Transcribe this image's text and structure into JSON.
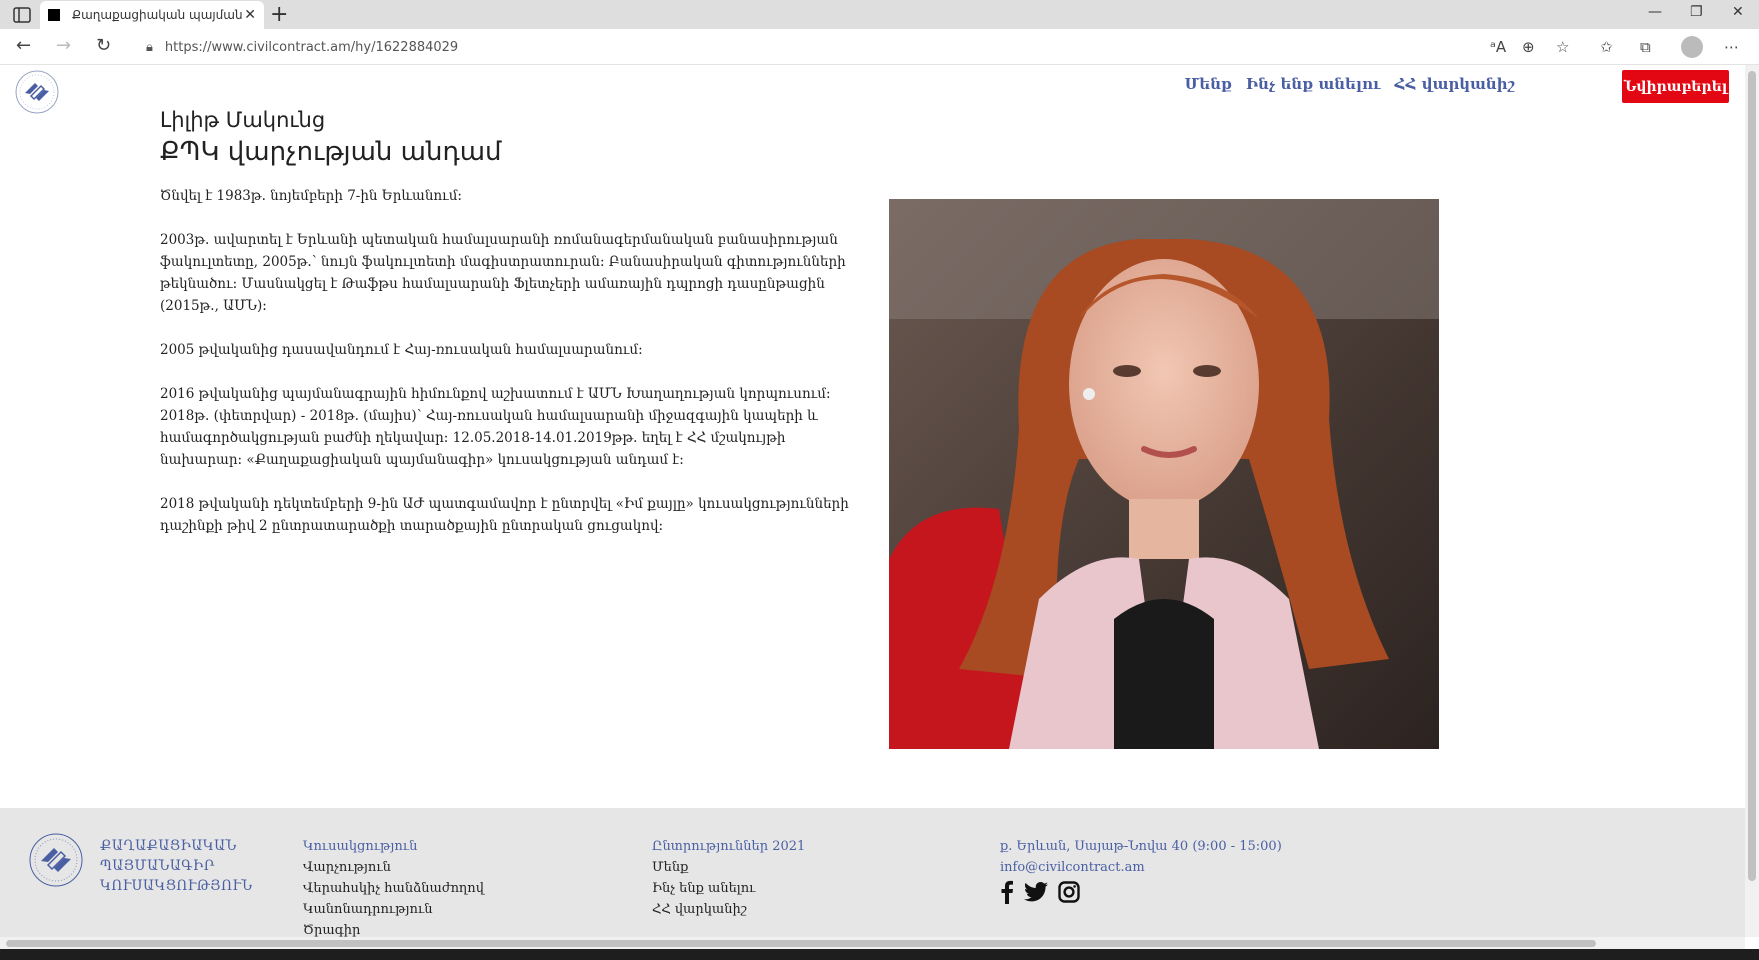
{
  "browser": {
    "tab_title": "Քաղաքացիական պայմանագ",
    "url": "https://www.civilcontract.am/hy/1622884029"
  },
  "site": {
    "nav": [
      "Մենք",
      "Ինչ ենք անելու",
      "ՀՀ վարկանիշ"
    ],
    "donate_label": "Նվիրաբերել"
  },
  "profile": {
    "name": "Լիլիթ Մակունց",
    "role": "ՔՊԿ վարչության անդամ",
    "bio": [
      "Ծնվել է 1983թ. նոյեմբերի 7-ին Երևանում:",
      "2003թ. ավարտել է Երևանի պետական համալսարանի ռոմանագերմանական բանասիրության ֆակուլտետը, 2005թ.՝ նույն ֆակուլտետի մագիստրատուրան: Բանասիրական գիտությունների թեկնածու: Մասնակցել է Թաֆթս համալսարանի Ֆլետչերի ամառային դպրոցի դասընթացին (2015թ., ԱՄՆ):",
      "2005 թվականից դասավանդում է Հայ-ռուսական համալսարանում:",
      "2016 թվականից պայմանագրային հիմունքով աշխատում է ԱՄՆ Խաղաղության կորպուսում: 2018թ. (փետրվար) - 2018թ. (մայիս)՝ Հայ-ռուսական համալսարանի միջազգային կապերի և համագործակցության բաժնի ղեկավար: 12.05.2018-14.01.2019թթ. եղել է ՀՀ մշակույթի նախարար: «Քաղաքացիական պայմանագիր» կուսակցության անդամ է:",
      "2018 թվականի դեկտեմբերի 9-ին ԱԺ պատգամավոր է ընտրվել «Իմ քայլը» կուսակցությունների դաշինքի թիվ 2 ընտրատարածքի տարածքային ընտրական ցուցակով:"
    ]
  },
  "footer": {
    "brand_lines": [
      "ՔԱՂԱՔԱՑԻԱԿԱՆ",
      "ՊԱՅՄԱՆԱԳԻՐ",
      "ԿՈՒՍԱԿՑՈՒԹՅՈՒՆ"
    ],
    "col1": {
      "heading": "Կուսակցություն",
      "items": [
        "Վարչություն",
        "Վերահսկիչ հանձնաժողով",
        "Կանոնադրություն",
        "Ծրագիր"
      ]
    },
    "col2": {
      "heading": "Ընտրություններ 2021",
      "items": [
        "Մենք",
        "Ինչ ենք անելու",
        "ՀՀ վարկանիշ"
      ]
    },
    "col3": {
      "address": "ք. Երևան, Սայաթ-Նովա 40 (9:00 - 15:00)",
      "email": "info@civilcontract.am"
    }
  },
  "colors": {
    "accent": "#4a5fa3",
    "donate": "#e30613",
    "footer_bg": "#e6e6e6"
  }
}
